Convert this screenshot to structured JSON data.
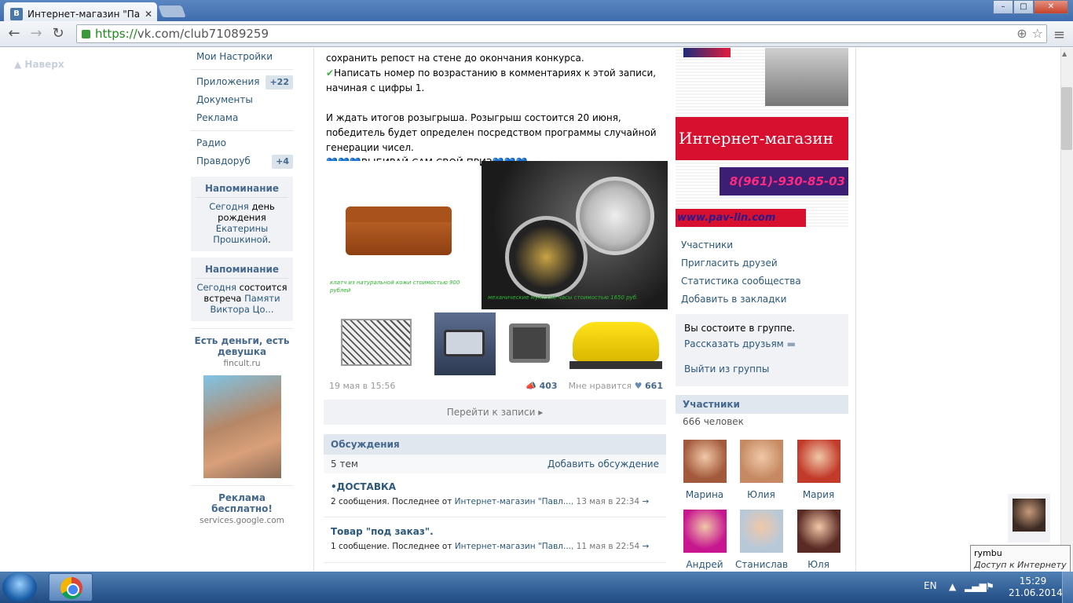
{
  "browser": {
    "tab_title": "Интернет-магазин \"Павл",
    "url_proto": "https://",
    "url_rest": "vk.com/club71089259",
    "win_min": "–",
    "win_max": "□",
    "win_close": "✕"
  },
  "page": {
    "up_link": "Наверх",
    "left_nav": [
      {
        "label": "Мои Настройки",
        "count": ""
      },
      {
        "label": "Приложения",
        "count": "+22"
      },
      {
        "label": "Документы",
        "count": ""
      },
      {
        "label": "Реклама",
        "count": ""
      },
      {
        "label": "Радио",
        "count": ""
      },
      {
        "label": "Правдоруб",
        "count": "+4"
      }
    ],
    "reminder1": {
      "title": "Напоминание",
      "l1": "Сегодня",
      "t1": " день рождения ",
      "l2": "Екатерины Прошкиной",
      "t2": "."
    },
    "reminder2": {
      "title": "Напоминание",
      "l1": "Сегодня",
      "t1": " состоится встреча ",
      "l2": "Памяти Виктора Цо..."
    },
    "ad1": {
      "title": "Есть деньги, есть девушка",
      "domain": "fincult.ru"
    },
    "ad2": {
      "title": "Реклама бесплатно!",
      "domain": "services.google.com"
    },
    "post": {
      "line1": "сохранить репост на стене до окончания конкурса.",
      "line2": "Написать номер по возрастанию в комментариях к этой записи, начиная с цифры 1.",
      "line3": "И ждать итогов розыгрыша. Розыгрыш состоится 20 июня, победитель будет определен посредством программы случайной генерации чисел.",
      "hearts": "💙💙💙",
      "line4": "ВЫБИРАЙ САМ СВОЙ ПРИЗ",
      "check": "✔",
      "photo1_caption": "клатч из натуральной кожи стоимостью 900 рублей",
      "photo2_caption": "механические мужские часы стоимостью 1650 руб.",
      "date": "19 мая в 15:56",
      "reposts": "403",
      "likes_label": "Мне нравится",
      "likes": "661",
      "goto": "Перейти к записи"
    },
    "discussions": {
      "title": "Обсуждения",
      "count": "5 тем",
      "add": "Добавить обсуждение",
      "topics": [
        {
          "title": "•ДОСТАВКА",
          "msgs": "2 сообщения. Последнее от ",
          "author": "Интернет-магазин \"Павл...",
          "date": ", 13 мая в 22:34",
          "arrow": "→"
        },
        {
          "title": "Товар \"под заказ\".",
          "msgs": "1 сообщение. Последнее от ",
          "author": "Интернет-магазин \"Павл...",
          "date": ", 11 мая в 22:54",
          "arrow": "→"
        }
      ]
    },
    "banner": {
      "shop": "Интернет-магазин",
      "phone": "8(961)-930-85-03",
      "site": "www.pav-lin.com"
    },
    "right_links": [
      "Участники",
      "Пригласить друзей",
      "Статистика сообщества",
      "Добавить в закладки"
    ],
    "join": {
      "status": "Вы состоите в группе.",
      "tell": "Рассказать друзьям",
      "leave": "Выйти из группы"
    },
    "members": {
      "title": "Участники",
      "count": "666 человек",
      "list": [
        {
          "name": "Марина",
          "color": "#a35a3c"
        },
        {
          "name": "Юлия",
          "color": "#c58a62"
        },
        {
          "name": "Мария",
          "color": "#c23a2a"
        },
        {
          "name": "Андрей",
          "color": "#c7168f"
        },
        {
          "name": "Станислав",
          "color": "#b7c9d9"
        },
        {
          "name": "Юля",
          "color": "#5a2a24"
        }
      ]
    },
    "chat_tooltip": {
      "name": "rymbu",
      "status": "Доступ к Интернету"
    }
  },
  "taskbar": {
    "lang": "EN",
    "time": "15:29",
    "date": "21.06.2014"
  }
}
